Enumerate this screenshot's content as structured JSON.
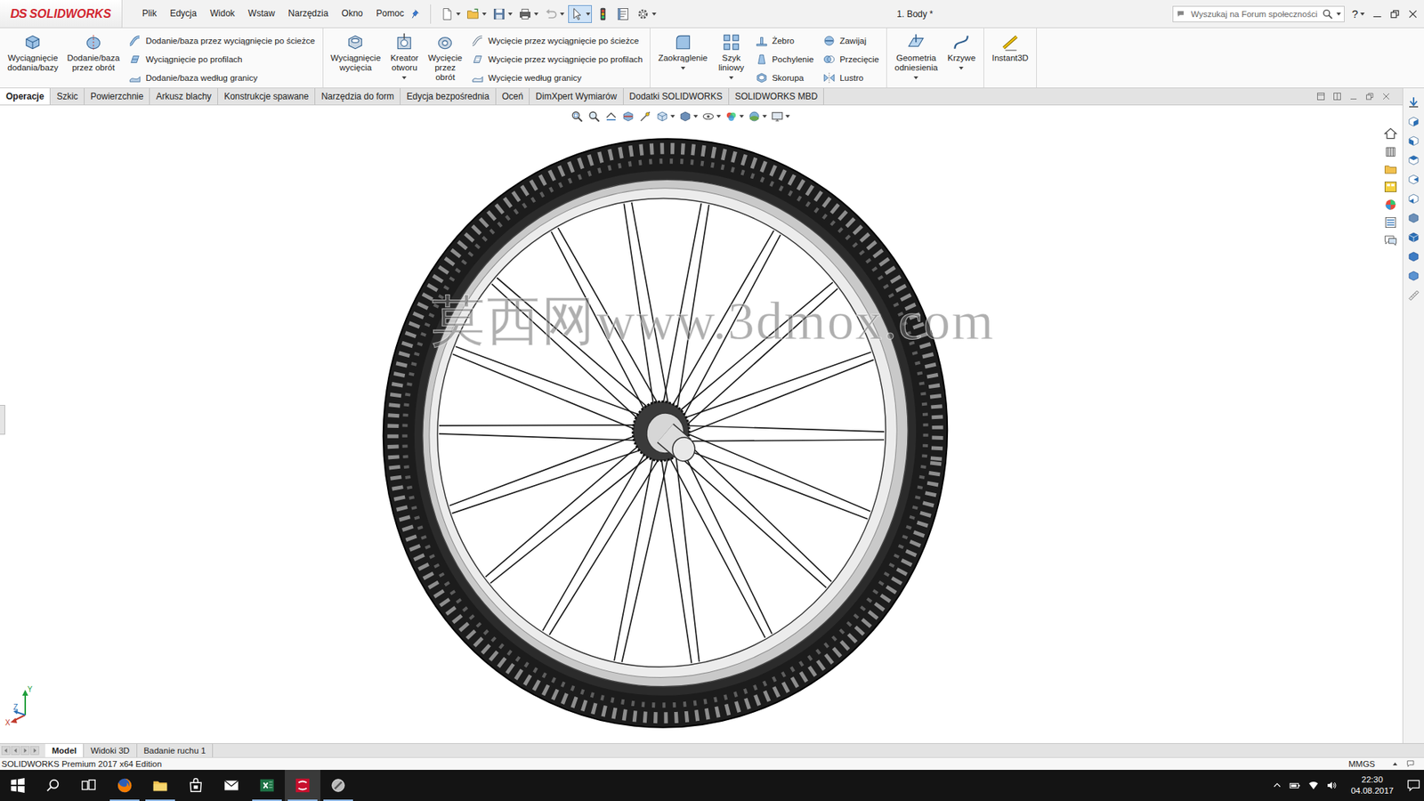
{
  "app": {
    "logo_mark": "DS",
    "logo": "SOLIDWORKS"
  },
  "menu": [
    "Plik",
    "Edycja",
    "Widok",
    "Wstaw",
    "Narzędzia",
    "Okno",
    "Pomoc"
  ],
  "quick_access": {
    "select_active": true
  },
  "window": {
    "title": "1. Body *"
  },
  "search": {
    "placeholder": "Wyszukaj na Forum społeczności"
  },
  "help": "?",
  "ribbon": [
    {
      "items": [
        {
          "kind": "large",
          "label": "Wyciągnięcie\ndodania/bazy",
          "dropdown": false
        },
        {
          "kind": "large",
          "label": "Dodanie/baza\nprzez obrót",
          "dropdown": false
        },
        {
          "kind": "stack",
          "entries": [
            "Dodanie/baza przez wyciągnięcie po ścieżce",
            "Wyciągnięcie po profilach",
            "Dodanie/baza według granicy"
          ]
        }
      ]
    },
    {
      "items": [
        {
          "kind": "large",
          "label": "Wyciągnięcie\nwycięcia",
          "dropdown": false
        },
        {
          "kind": "large",
          "label": "Kreator\notworu",
          "dropdown": true
        },
        {
          "kind": "large",
          "label": "Wycięcie\nprzez\nobrót",
          "dropdown": false
        },
        {
          "kind": "stack",
          "entries": [
            "Wycięcie przez wyciągnięcie po ścieżce",
            "Wycięcie przez wyciągnięcie po profilach",
            "Wycięcie według granicy"
          ]
        }
      ]
    },
    {
      "items": [
        {
          "kind": "large",
          "label": "Zaokrąglenie",
          "dropdown": true
        },
        {
          "kind": "large",
          "label": "Szyk\nliniowy",
          "dropdown": true
        },
        {
          "kind": "stack",
          "entries": [
            "Żebro",
            "Pochylenie",
            "Skorupa"
          ]
        },
        {
          "kind": "stack",
          "entries": [
            "Zawijaj",
            "Przecięcie",
            "Lustro"
          ]
        }
      ]
    },
    {
      "items": [
        {
          "kind": "large",
          "label": "Geometria\nodniesienia",
          "dropdown": true
        },
        {
          "kind": "large",
          "label": "Krzywe",
          "dropdown": true
        }
      ]
    },
    {
      "items": [
        {
          "kind": "large",
          "label": "Instant3D",
          "dropdown": false
        }
      ]
    }
  ],
  "tabs": [
    {
      "label": "Operacje",
      "selected": true
    },
    {
      "label": "Szkic",
      "selected": false
    },
    {
      "label": "Powierzchnie",
      "selected": false
    },
    {
      "label": "Arkusz blachy",
      "selected": false
    },
    {
      "label": "Konstrukcje spawane",
      "selected": false
    },
    {
      "label": "Narzędzia do form",
      "selected": false
    },
    {
      "label": "Edycja bezpośrednia",
      "selected": false
    },
    {
      "label": "Oceń",
      "selected": false
    },
    {
      "label": "DimXpert Wymiarów",
      "selected": false
    },
    {
      "label": "Dodatki SOLIDWORKS",
      "selected": false
    },
    {
      "label": "SOLIDWORKS MBD",
      "selected": false
    }
  ],
  "viewport": {
    "watermark": "莫西网www.3dmox.com",
    "triad": {
      "x": "X",
      "y": "Y",
      "z": "Z"
    }
  },
  "bottom_tabs": [
    {
      "label": "Model",
      "selected": true
    },
    {
      "label": "Widoki 3D",
      "selected": false
    },
    {
      "label": "Badanie ruchu 1",
      "selected": false
    }
  ],
  "status_bar": {
    "edition": "SOLIDWORKS Premium 2017 x64 Edition",
    "units": "MMGS"
  },
  "taskbar": {
    "apps": [
      {
        "running": true,
        "active": false
      },
      {
        "running": true,
        "active": false
      },
      {
        "running": false,
        "active": false
      },
      {
        "running": false,
        "active": false
      },
      {
        "running": true,
        "active": false
      },
      {
        "running": true,
        "active": true
      },
      {
        "running": true,
        "active": false
      }
    ],
    "time": "22:30",
    "date": "04.08.2017"
  }
}
